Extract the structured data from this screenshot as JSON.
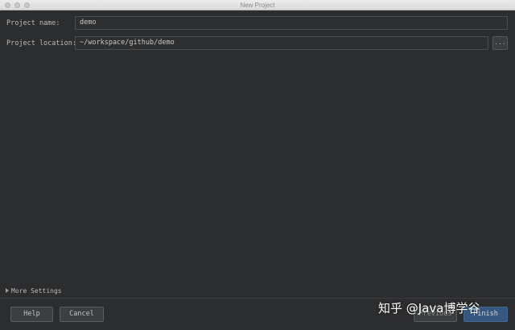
{
  "window": {
    "title": "New Project"
  },
  "form": {
    "project_name_label": "Project name:",
    "project_name_value": "demo",
    "project_location_label": "Project location:",
    "project_location_value": "~/workspace/github/demo",
    "browse_label": "..."
  },
  "more_settings": {
    "label": "More Settings"
  },
  "buttons": {
    "help": "Help",
    "cancel": "Cancel",
    "previous": "Previous",
    "finish": "Finish"
  },
  "watermark": {
    "text": "知乎 @Java博学谷"
  }
}
